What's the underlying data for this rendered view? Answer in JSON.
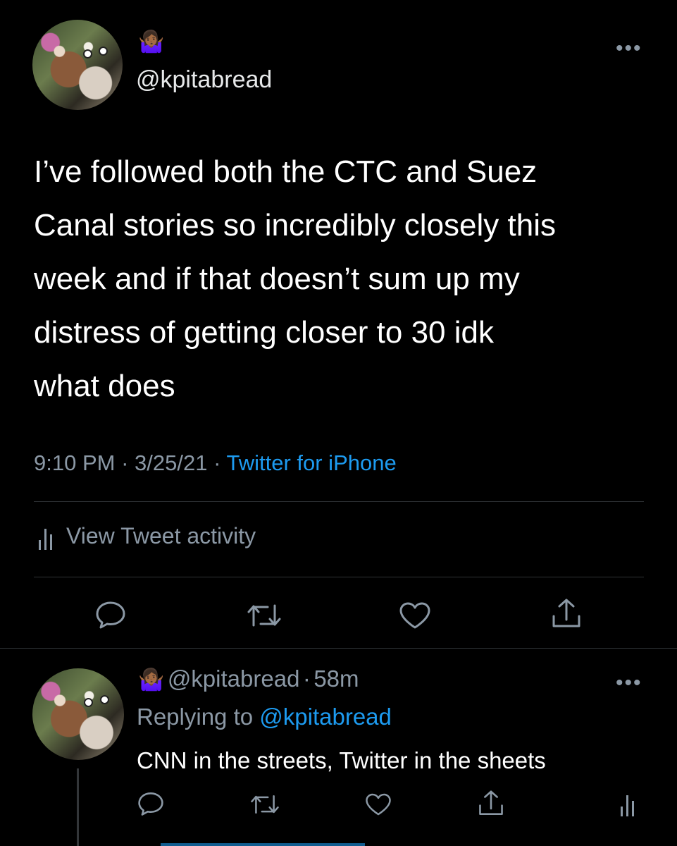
{
  "tweet": {
    "emoji": "🤷🏾‍♀️",
    "handle": "@kpitabread",
    "text": "I’ve followed both the CTC and Suez\nCanal stories so incredibly closely this\nweek and if that doesn’t sum up my\ndistress of getting closer to 30 idk\nwhat does",
    "time": "9:10 PM",
    "sep1": "·",
    "date": "3/25/21",
    "sep2": "·",
    "source": "Twitter for iPhone",
    "activity_label": "View Tweet activity",
    "more": "•••"
  },
  "reply": {
    "emoji": "🤷🏾‍♀️",
    "handle": "@kpitabread",
    "sep": "·",
    "age": "58m",
    "replying_prefix": "Replying to",
    "replying_handle": "@kpitabread",
    "text": "CNN in the streets, Twitter in the sheets",
    "more": "•••"
  },
  "colors": {
    "link": "#1d9bf0",
    "muted": "#8b98a5",
    "background": "#000000"
  }
}
